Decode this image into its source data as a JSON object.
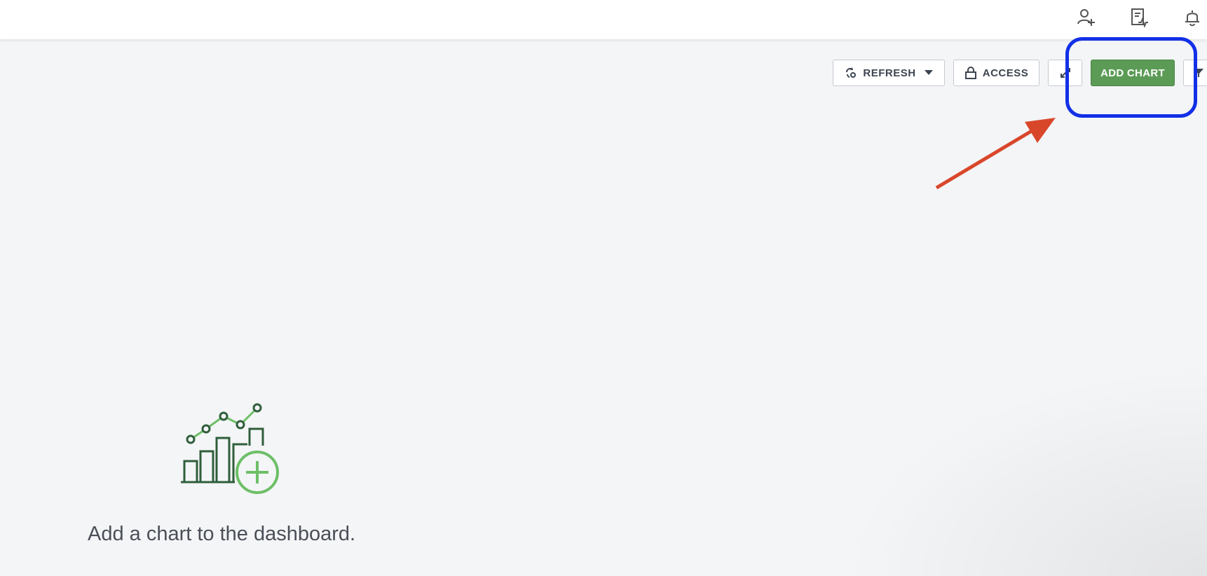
{
  "header": {
    "icons": [
      "invite-user-icon",
      "activity-log-icon",
      "bell-icon"
    ]
  },
  "toolbar": {
    "refresh_label": "REFRESH",
    "access_label": "ACCESS",
    "add_chart_label": "ADD CHART"
  },
  "empty_state": {
    "message": "Add a chart to the dashboard.",
    "icon": "chart-add-icon"
  },
  "colors": {
    "add_chart_bg": "#5b9b55",
    "highlight": "#1230e6",
    "arrow": "#d9472b",
    "page_bg": "#f4f5f7"
  }
}
